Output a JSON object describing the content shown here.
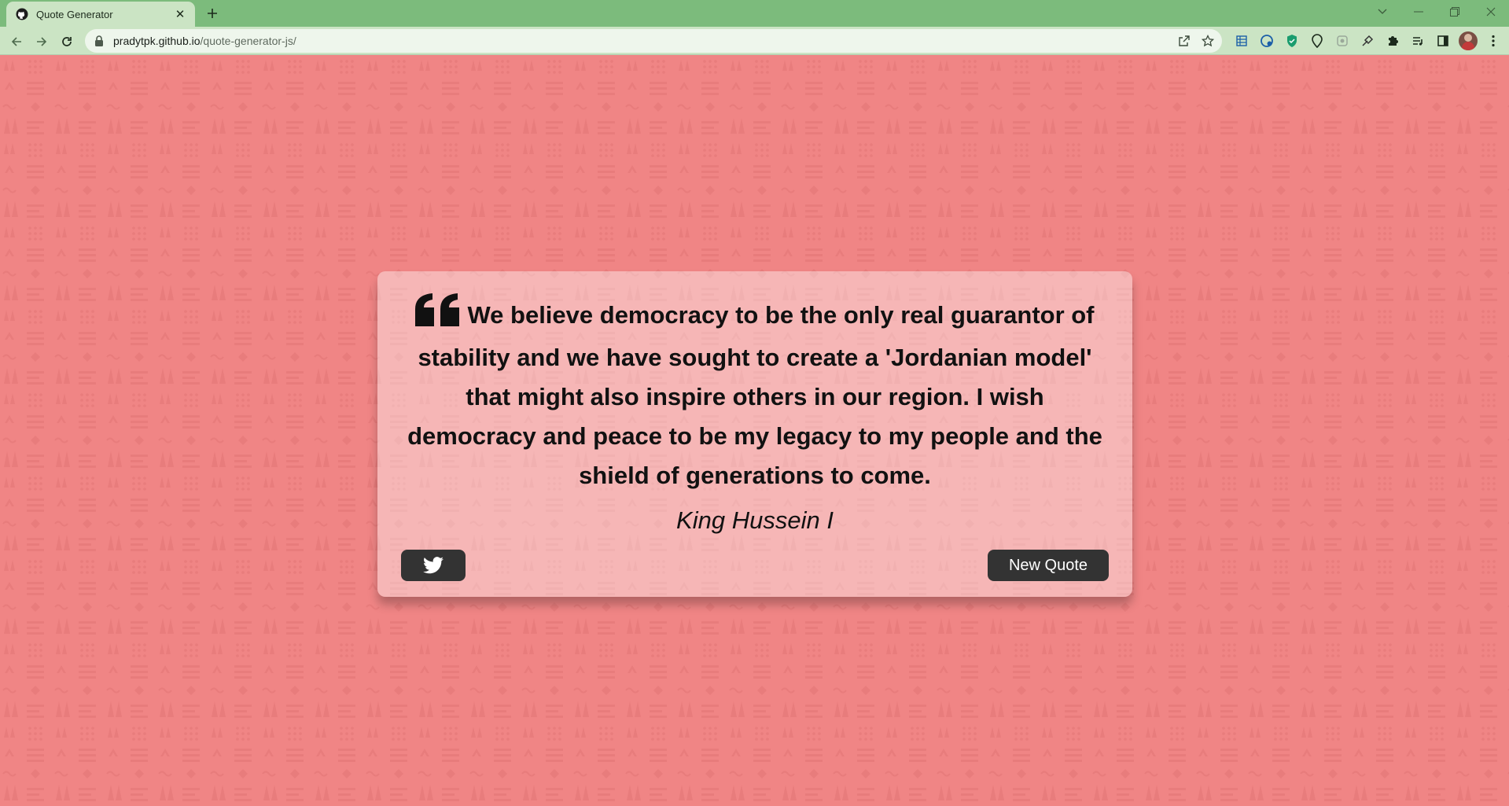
{
  "browser": {
    "tab_title": "Quote Generator",
    "url_host": "pradytpk.github.io",
    "url_path": "/quote-generator-js/",
    "icons": {
      "favicon": "github-icon",
      "back": "arrow-left-icon",
      "forward": "arrow-right-icon",
      "reload": "reload-icon",
      "lock": "lock-icon",
      "share": "share-icon",
      "bookmark": "star-icon",
      "extensions": "puzzle-icon"
    }
  },
  "quote": {
    "text": "We believe democracy to be the only real guarantor of stability and we have sought to create a 'Jordanian model' that might also inspire others in our region. I wish democracy and peace to be my legacy to my people and the shield of generations to come.",
    "author": "King Hussein I"
  },
  "buttons": {
    "twitter_icon": "twitter-icon",
    "new_quote_label": "New Quote"
  },
  "colors": {
    "background": "#f08585",
    "card": "rgba(255,255,255,0.4)",
    "button": "#333333",
    "browser_frame": "#7cbb7c"
  }
}
